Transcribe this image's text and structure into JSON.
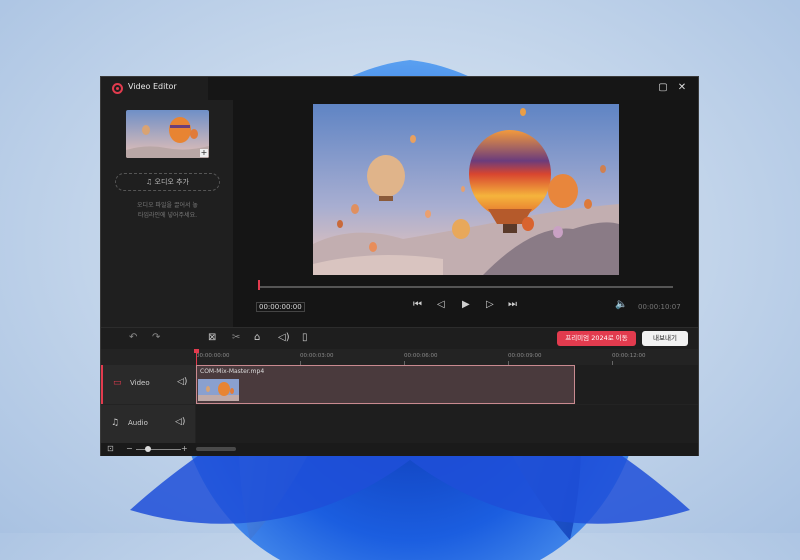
{
  "app": {
    "title": "Video Editor"
  },
  "window_buttons": {
    "restore": "▢",
    "close": "✕"
  },
  "media": {
    "add_audio_label": "♫ 오디오 추가",
    "hint_line1": "오디오 파일을 끌어서 놓",
    "hint_line2": "타임라인에 넣어주세요."
  },
  "player": {
    "current_time": "00:00:00:00",
    "total_time": "00:00:10:07"
  },
  "toolbar": {
    "upgrade_label": "프리미엄 2024로 이동",
    "export_label": "내보내기"
  },
  "timeline": {
    "ticks": [
      "00:00:00:00",
      "00:00:03:00",
      "00:00:06:00",
      "00:00:09:00",
      "00:00:12:00"
    ],
    "tracks": [
      {
        "label": "Video",
        "icon": "video-icon"
      },
      {
        "label": "Audio",
        "icon": "music-icon"
      }
    ],
    "clip_name": "COM-Mix-Master.mp4"
  },
  "colors": {
    "accent": "#e23b4e",
    "window_bg": "#1b1b1b"
  }
}
